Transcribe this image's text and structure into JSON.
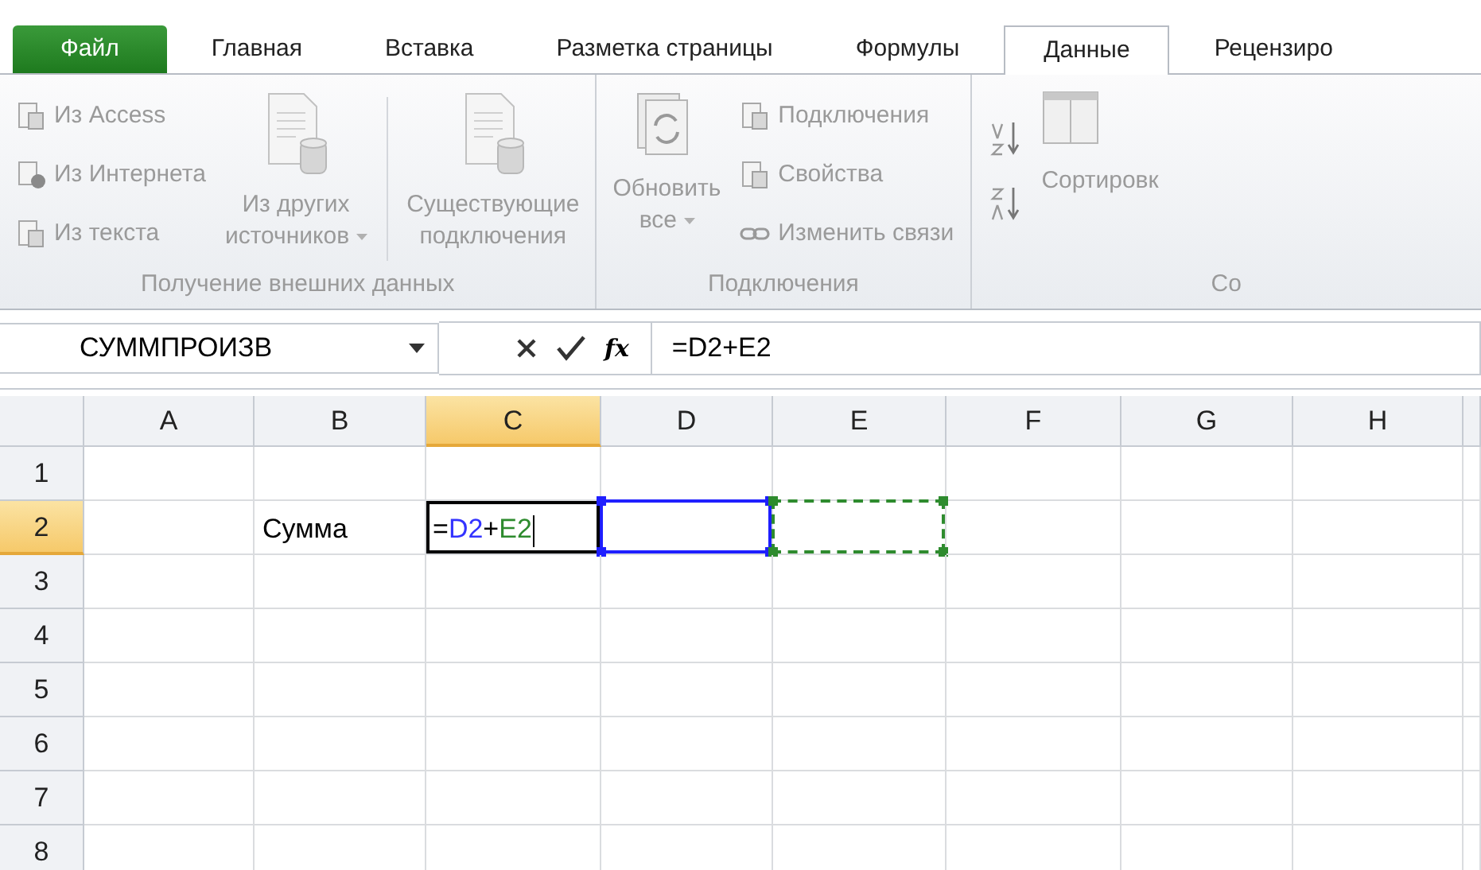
{
  "tabs": [
    {
      "label": "Файл",
      "kind": "file",
      "selected": false
    },
    {
      "label": "Главная",
      "kind": "normal",
      "selected": false
    },
    {
      "label": "Вставка",
      "kind": "normal",
      "selected": false
    },
    {
      "label": "Разметка страницы",
      "kind": "normal",
      "selected": false
    },
    {
      "label": "Формулы",
      "kind": "normal",
      "selected": false
    },
    {
      "label": "Данные",
      "kind": "normal",
      "selected": true
    },
    {
      "label": "Рецензиро",
      "kind": "normal",
      "selected": false
    }
  ],
  "ribbon": {
    "disabled": true,
    "groups": [
      {
        "label": "Получение внешних данных",
        "items": [
          {
            "kind": "small-stack",
            "buttons": [
              {
                "label": "Из Access"
              },
              {
                "label": "Из Интернета"
              },
              {
                "label": "Из текста"
              }
            ]
          },
          {
            "kind": "large",
            "lines": [
              "Из других",
              "источников"
            ],
            "dropdown": true
          },
          {
            "kind": "large",
            "lines": [
              "Существующие",
              "подключения"
            ],
            "dropdown": false
          }
        ]
      },
      {
        "label": "Подключения",
        "items": [
          {
            "kind": "large",
            "lines": [
              "Обновить",
              "все"
            ],
            "dropdown": true
          },
          {
            "kind": "small-stack",
            "buttons": [
              {
                "label": "Подключения"
              },
              {
                "label": "Свойства"
              },
              {
                "label": "Изменить связи"
              }
            ]
          }
        ]
      },
      {
        "label": "Со",
        "items": [
          {
            "kind": "sort-pair"
          },
          {
            "kind": "large-sort",
            "lines": [
              "Сортировк"
            ]
          }
        ]
      }
    ]
  },
  "formula_bar": {
    "name_box": "СУММПРОИЗВ",
    "function_button": "fx",
    "formula": "=D2+E2"
  },
  "columns": [
    {
      "label": "A",
      "selected": false
    },
    {
      "label": "B",
      "selected": false
    },
    {
      "label": "C",
      "selected": true
    },
    {
      "label": "D",
      "selected": false
    },
    {
      "label": "E",
      "selected": false
    },
    {
      "label": "F",
      "selected": false
    },
    {
      "label": "G",
      "selected": false
    },
    {
      "label": "H",
      "selected": false
    }
  ],
  "rows": [
    {
      "label": "1",
      "selected": false,
      "cells": []
    },
    {
      "label": "2",
      "selected": true,
      "cells": [
        {
          "kind": "empty"
        },
        {
          "kind": "text",
          "text": "Сумма"
        },
        {
          "kind": "editing",
          "parts": [
            {
              "text": "=",
              "color": "#000000"
            },
            {
              "text": "D2",
              "color": "#3333ff"
            },
            {
              "text": "+",
              "color": "#000000"
            },
            {
              "text": "E2",
              "color": "#2e8b2e"
            }
          ]
        },
        {
          "kind": "reference",
          "color": "#1f1fff",
          "dashed": false
        },
        {
          "kind": "reference",
          "color": "#2e8b2e",
          "dashed": true
        }
      ]
    },
    {
      "label": "3",
      "selected": false,
      "cells": []
    },
    {
      "label": "4",
      "selected": false,
      "cells": []
    },
    {
      "label": "5",
      "selected": false,
      "cells": []
    },
    {
      "label": "6",
      "selected": false,
      "cells": []
    },
    {
      "label": "7",
      "selected": false,
      "cells": []
    },
    {
      "label": "8",
      "selected": false,
      "cells": []
    }
  ]
}
